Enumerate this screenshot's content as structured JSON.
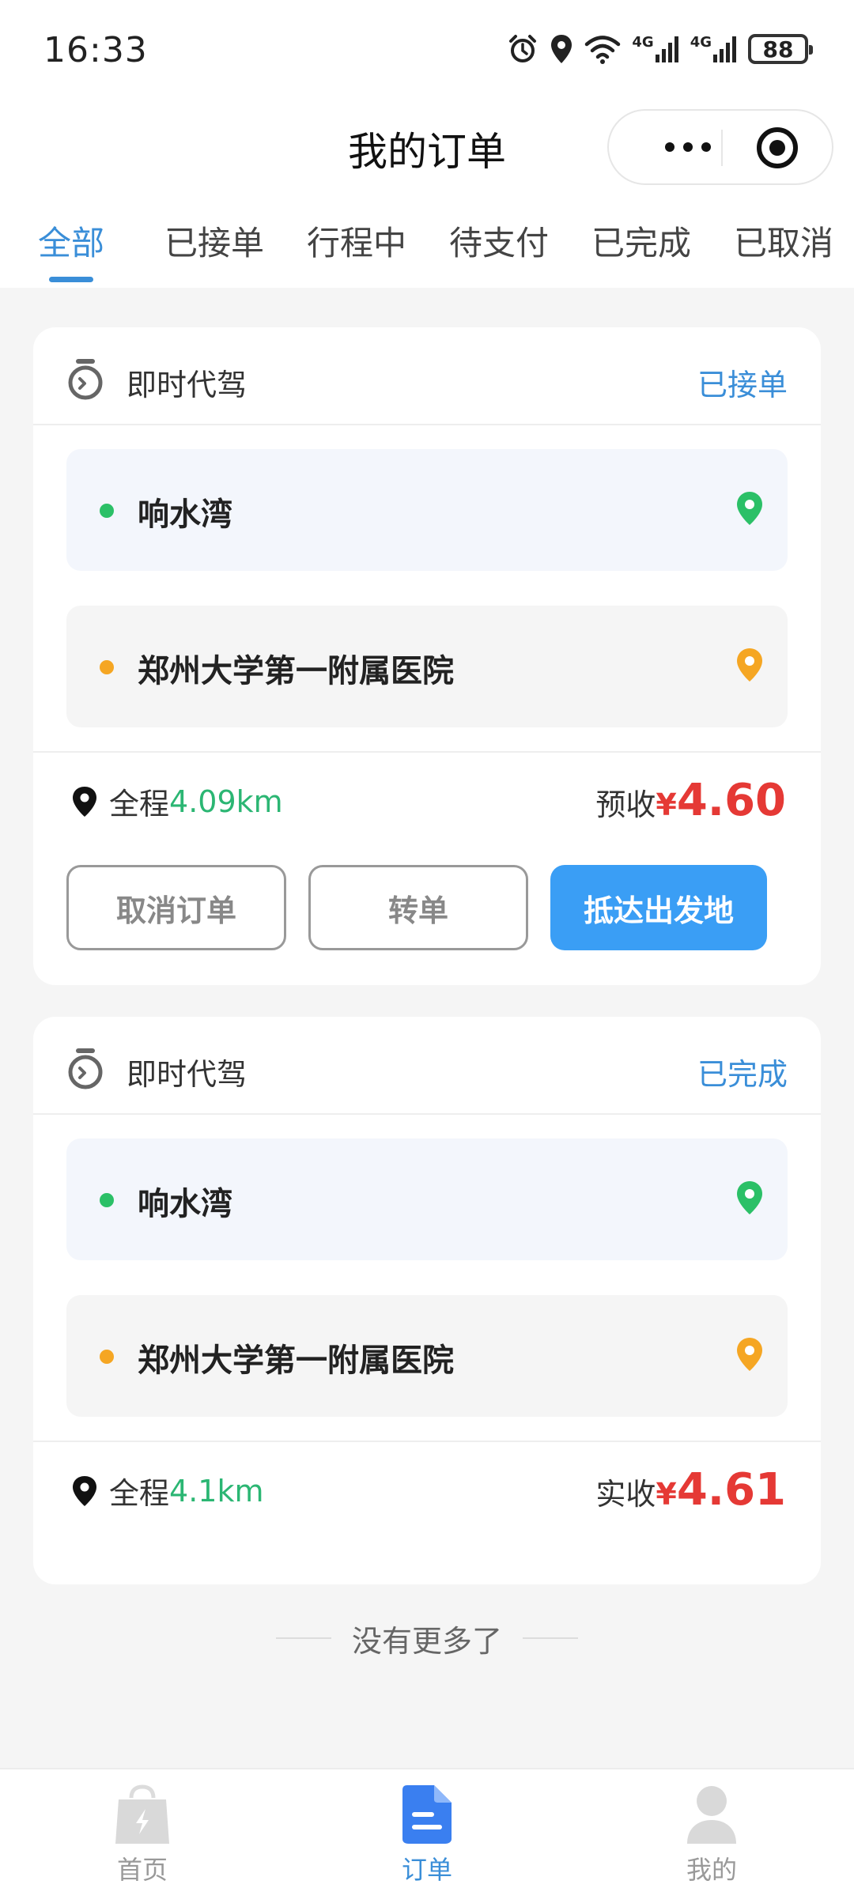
{
  "status_bar": {
    "time": "16:33",
    "network1": "4G",
    "network2": "4G",
    "battery": "88"
  },
  "nav": {
    "title": "我的订单"
  },
  "tabs": [
    {
      "label": "全部",
      "active": true
    },
    {
      "label": "已接单",
      "active": false
    },
    {
      "label": "行程中",
      "active": false
    },
    {
      "label": "待支付",
      "active": false
    },
    {
      "label": "已完成",
      "active": false
    },
    {
      "label": "已取消",
      "active": false
    }
  ],
  "orders": [
    {
      "type": "即时代驾",
      "status": "已接单",
      "from": "响水湾",
      "to": "郑州大学第一附属医院",
      "distance_label": "全程",
      "distance": "4.09km",
      "fare_label": "预收",
      "currency": "¥",
      "fare": "4.60",
      "buttons": {
        "cancel": "取消订单",
        "transfer": "转单",
        "arrive": "抵达出发地"
      }
    },
    {
      "type": "即时代驾",
      "status": "已完成",
      "from": "响水湾",
      "to": "郑州大学第一附属医院",
      "distance_label": "全程",
      "distance": "4.1km",
      "fare_label": "实收",
      "currency": "¥",
      "fare": "4.61"
    }
  ],
  "end_text": "没有更多了",
  "tabbar": [
    {
      "label": "首页",
      "icon": "shopping-bag-icon",
      "active": false
    },
    {
      "label": "订单",
      "icon": "order-document-icon",
      "active": true
    },
    {
      "label": "我的",
      "icon": "user-avatar-icon",
      "active": false
    }
  ],
  "colors": {
    "accent": "#3a8ed8",
    "primary_button": "#3a9ef5",
    "price": "#e53935",
    "distance": "#2bb673",
    "origin_dot": "#2bc067",
    "destination_dot": "#f5a623"
  }
}
